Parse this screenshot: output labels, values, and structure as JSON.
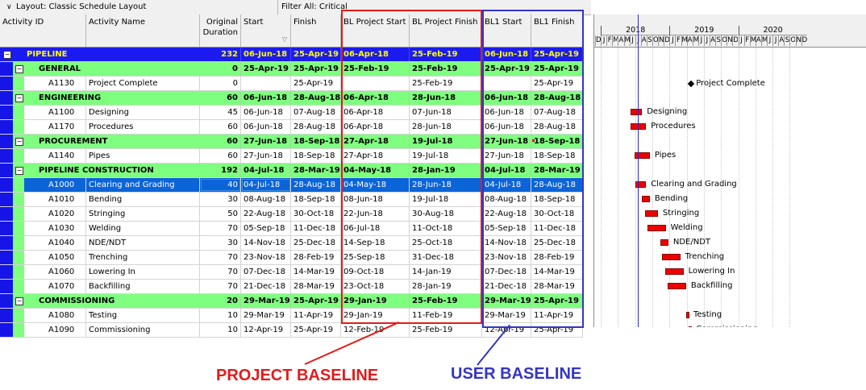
{
  "toolbar": {
    "layout_label": "Layout: Classic Schedule Layout",
    "filter_label": "Filter All: Critical"
  },
  "columns": {
    "activity_id": "Activity ID",
    "activity_name": "Activity Name",
    "original_duration": "Original Duration",
    "start": "Start",
    "finish": "Finish",
    "bl_project_start": "BL Project Start",
    "bl_project_finish": "BL Project Finish",
    "bl1_start": "BL1 Start",
    "bl1_finish": "BL1 Finish"
  },
  "rows": [
    {
      "kind": "wbs1",
      "name": "PIPELINE",
      "dur": "232",
      "start": "06-Jun-18",
      "finish": "25-Apr-19",
      "blps": "06-Apr-18",
      "blpf": "25-Feb-19",
      "bl1s": "06-Jun-18",
      "bl1f": "25-Apr-19"
    },
    {
      "kind": "wbs2",
      "name": "GENERAL",
      "dur": "0",
      "start": "25-Apr-19",
      "finish": "25-Apr-19",
      "blps": "25-Feb-19",
      "blpf": "25-Feb-19",
      "bl1s": "25-Apr-19",
      "bl1f": "25-Apr-19"
    },
    {
      "kind": "act",
      "id": "A1130",
      "name": "Project Complete",
      "dur": "0",
      "start": "",
      "finish": "25-Apr-19",
      "blps": "",
      "blpf": "25-Feb-19",
      "bl1s": "",
      "bl1f": "25-Apr-19"
    },
    {
      "kind": "wbs2",
      "name": "ENGINEERING",
      "dur": "60",
      "start": "06-Jun-18",
      "finish": "28-Aug-18",
      "blps": "06-Apr-18",
      "blpf": "28-Jun-18",
      "bl1s": "06-Jun-18",
      "bl1f": "28-Aug-18"
    },
    {
      "kind": "act",
      "id": "A1100",
      "name": "Designing",
      "dur": "45",
      "start": "06-Jun-18",
      "finish": "07-Aug-18",
      "blps": "06-Apr-18",
      "blpf": "07-Jun-18",
      "bl1s": "06-Jun-18",
      "bl1f": "07-Aug-18"
    },
    {
      "kind": "act",
      "id": "A1170",
      "name": "Procedures",
      "dur": "60",
      "start": "06-Jun-18",
      "finish": "28-Aug-18",
      "blps": "06-Apr-18",
      "blpf": "28-Jun-18",
      "bl1s": "06-Jun-18",
      "bl1f": "28-Aug-18"
    },
    {
      "kind": "wbs2",
      "name": "PROCUREMENT",
      "dur": "60",
      "start": "27-Jun-18",
      "finish": "18-Sep-18",
      "blps": "27-Apr-18",
      "blpf": "19-Jul-18",
      "bl1s": "27-Jun-18",
      "bl1f": "18-Sep-18"
    },
    {
      "kind": "act",
      "id": "A1140",
      "name": "Pipes",
      "dur": "60",
      "start": "27-Jun-18",
      "finish": "18-Sep-18",
      "blps": "27-Apr-18",
      "blpf": "19-Jul-18",
      "bl1s": "27-Jun-18",
      "bl1f": "18-Sep-18"
    },
    {
      "kind": "wbs2",
      "name": "PIPELINE CONSTRUCTION",
      "dur": "192",
      "start": "04-Jul-18",
      "finish": "28-Mar-19",
      "blps": "04-May-18",
      "blpf": "28-Jan-19",
      "bl1s": "04-Jul-18",
      "bl1f": "28-Mar-19"
    },
    {
      "kind": "sel",
      "id": "A1000",
      "name": "Clearing and Grading",
      "dur": "40",
      "start": "04-Jul-18",
      "finish": "28-Aug-18",
      "blps": "04-May-18",
      "blpf": "28-Jun-18",
      "bl1s": "04-Jul-18",
      "bl1f": "28-Aug-18"
    },
    {
      "kind": "act",
      "id": "A1010",
      "name": "Bending",
      "dur": "30",
      "start": "08-Aug-18",
      "finish": "18-Sep-18",
      "blps": "08-Jun-18",
      "blpf": "19-Jul-18",
      "bl1s": "08-Aug-18",
      "bl1f": "18-Sep-18"
    },
    {
      "kind": "act",
      "id": "A1020",
      "name": "Stringing",
      "dur": "50",
      "start": "22-Aug-18",
      "finish": "30-Oct-18",
      "blps": "22-Jun-18",
      "blpf": "30-Aug-18",
      "bl1s": "22-Aug-18",
      "bl1f": "30-Oct-18"
    },
    {
      "kind": "act",
      "id": "A1030",
      "name": "Welding",
      "dur": "70",
      "start": "05-Sep-18",
      "finish": "11-Dec-18",
      "blps": "06-Jul-18",
      "blpf": "11-Oct-18",
      "bl1s": "05-Sep-18",
      "bl1f": "11-Dec-18"
    },
    {
      "kind": "act",
      "id": "A1040",
      "name": "NDE/NDT",
      "dur": "30",
      "start": "14-Nov-18",
      "finish": "25-Dec-18",
      "blps": "14-Sep-18",
      "blpf": "25-Oct-18",
      "bl1s": "14-Nov-18",
      "bl1f": "25-Dec-18"
    },
    {
      "kind": "act",
      "id": "A1050",
      "name": "Trenching",
      "dur": "70",
      "start": "23-Nov-18",
      "finish": "28-Feb-19",
      "blps": "25-Sep-18",
      "blpf": "31-Dec-18",
      "bl1s": "23-Nov-18",
      "bl1f": "28-Feb-19"
    },
    {
      "kind": "act",
      "id": "A1060",
      "name": "Lowering In",
      "dur": "70",
      "start": "07-Dec-18",
      "finish": "14-Mar-19",
      "blps": "09-Oct-18",
      "blpf": "14-Jan-19",
      "bl1s": "07-Dec-18",
      "bl1f": "14-Mar-19"
    },
    {
      "kind": "act",
      "id": "A1070",
      "name": "Backfilling",
      "dur": "70",
      "start": "21-Dec-18",
      "finish": "28-Mar-19",
      "blps": "23-Oct-18",
      "blpf": "28-Jan-19",
      "bl1s": "21-Dec-18",
      "bl1f": "28-Mar-19"
    },
    {
      "kind": "wbs2",
      "name": "COMMISSIONING",
      "dur": "20",
      "start": "29-Mar-19",
      "finish": "25-Apr-19",
      "blps": "29-Jan-19",
      "blpf": "25-Feb-19",
      "bl1s": "29-Mar-19",
      "bl1f": "25-Apr-19"
    },
    {
      "kind": "act",
      "id": "A1080",
      "name": "Testing",
      "dur": "10",
      "start": "29-Mar-19",
      "finish": "11-Apr-19",
      "blps": "29-Jan-19",
      "blpf": "11-Feb-19",
      "bl1s": "29-Mar-19",
      "bl1f": "11-Apr-19"
    },
    {
      "kind": "act",
      "id": "A1090",
      "name": "Commissioning",
      "dur": "10",
      "start": "12-Apr-19",
      "finish": "25-Apr-19",
      "blps": "12-Feb-19",
      "blpf": "25-Feb-19",
      "bl1s": "12-Apr-19",
      "bl1f": "25-Apr-19"
    }
  ],
  "gantt": {
    "years": [
      "2018",
      "2019",
      "2020"
    ],
    "months": [
      "D",
      "J",
      "F",
      "M",
      "A",
      "M",
      "J",
      "J",
      "A",
      "S",
      "O",
      "N",
      "D",
      "J",
      "F",
      "M",
      "A",
      "M",
      "J",
      "J",
      "A",
      "S",
      "O",
      "N",
      "D",
      "J",
      "F",
      "M",
      "A",
      "M",
      "J",
      "J",
      "A",
      "S",
      "O",
      "N",
      "D"
    ],
    "bar_labels": [
      "Project Complete",
      "Designing",
      "Procedures",
      "Pipes",
      "Clearing and Grading",
      "Bending",
      "Stringing",
      "Welding",
      "NDE/NDT",
      "Trenching",
      "Lowering In",
      "Backfilling",
      "Testing",
      "Commissioning"
    ]
  },
  "annotations": {
    "project_baseline": "PROJECT BASELINE",
    "user_baseline": "USER BASELINE",
    "project_color": "#e31b1b",
    "user_color": "#3535c4"
  },
  "colors": {
    "wbs1_bg": "#1b1bf0",
    "wbs1_text": "#ffff00",
    "wbs2_bg": "#7fff7f",
    "selected_bg": "#0b64d8",
    "bar": "#ee0000"
  }
}
